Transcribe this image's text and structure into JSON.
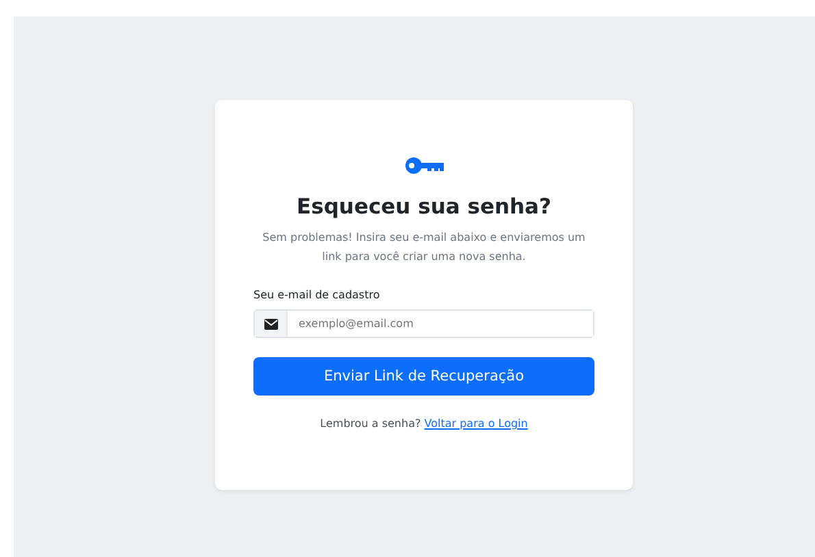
{
  "card": {
    "title": "Esqueceu sua senha?",
    "description": "Sem problemas! Insira seu e-mail abaixo e enviaremos um link para você criar uma nova senha.",
    "email_field": {
      "label": "Seu e-mail de cadastro",
      "placeholder": "exemplo@email.com"
    },
    "submit_button": "Enviar Link de Recuperação",
    "footer": {
      "text": "Lembrou a senha?",
      "link": "Voltar para o Login"
    }
  }
}
